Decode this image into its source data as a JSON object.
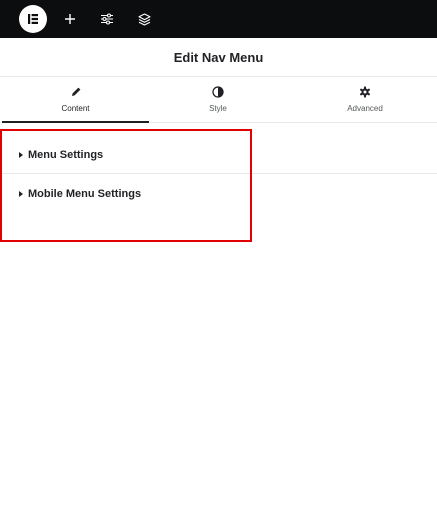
{
  "topbar": {
    "logo": "elementor-logo-icon",
    "buttons": [
      "add-element-icon",
      "site-settings-icon",
      "navigator-layers-icon"
    ]
  },
  "header": {
    "title": "Edit Nav Menu"
  },
  "tabs": [
    {
      "label": "Content",
      "icon": "pencil-icon",
      "active": true
    },
    {
      "label": "Style",
      "icon": "half-circle-icon",
      "active": false
    },
    {
      "label": "Advanced",
      "icon": "gear-icon",
      "active": false
    }
  ],
  "sections": [
    {
      "label": "Menu Settings"
    },
    {
      "label": "Mobile Menu Settings"
    }
  ],
  "colors": {
    "topbar_bg": "#0c0d0e",
    "highlight": "#e00000",
    "border": "#e6e8ea"
  }
}
